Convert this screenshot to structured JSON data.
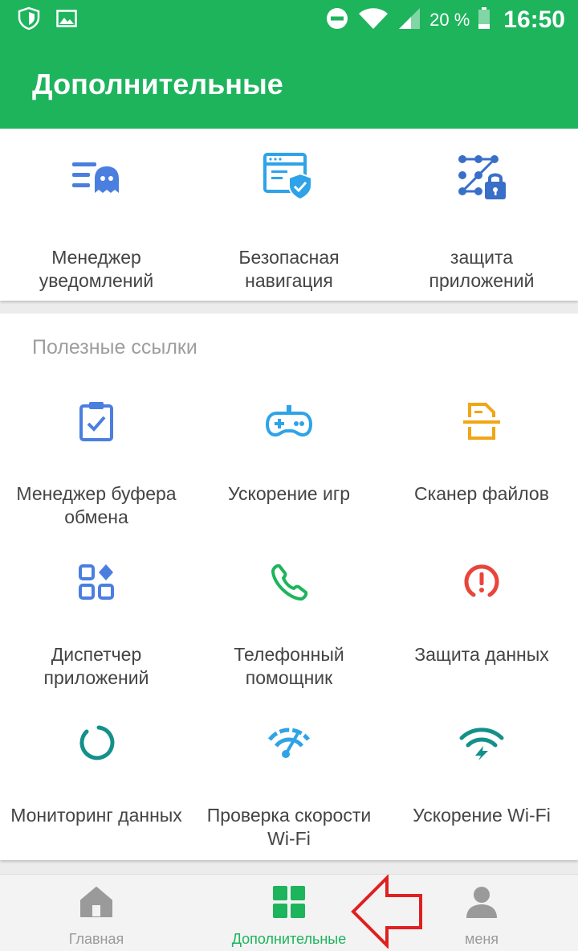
{
  "status_bar": {
    "battery": "20 %",
    "time": "16:50"
  },
  "header": {
    "title": "Дополнительные"
  },
  "top_tools": [
    {
      "line1": "Менеджер",
      "line2": "уведомлений",
      "icon": "notification-manager-icon"
    },
    {
      "line1": "Безопасная",
      "line2": "навигация",
      "icon": "safe-browsing-icon"
    },
    {
      "line1": "защита",
      "line2": "приложений",
      "icon": "app-lock-icon"
    }
  ],
  "useful_links": {
    "title": "Полезные ссылки",
    "items": [
      {
        "line1": "Менеджер буфера",
        "line2": "обмена",
        "icon": "clipboard-icon",
        "color": "#4a7fe0"
      },
      {
        "line1": "Ускорение игр",
        "line2": "",
        "icon": "gamepad-icon",
        "color": "#2ea3e8"
      },
      {
        "line1": "Сканер файлов",
        "line2": "",
        "icon": "file-scanner-icon",
        "color": "#f2a516"
      },
      {
        "line1": "Диспетчер",
        "line2": "приложений",
        "icon": "app-manager-icon",
        "color": "#4a7fe0"
      },
      {
        "line1": "Телефонный",
        "line2": "помощник",
        "icon": "phone-icon",
        "color": "#1db45c"
      },
      {
        "line1": "Защита данных",
        "line2": "",
        "icon": "data-protection-icon",
        "color": "#e8453c"
      },
      {
        "line1": "Мониторинг данных",
        "line2": "",
        "icon": "data-monitor-icon",
        "color": "#14908a"
      },
      {
        "line1": "Проверка скорости",
        "line2": "Wi-Fi",
        "icon": "speedometer-icon",
        "color": "#2ea3e8"
      },
      {
        "line1": "Ускорение Wi-Fi",
        "line2": "",
        "icon": "wifi-boost-icon",
        "color": "#14908a"
      }
    ]
  },
  "bottom_nav": [
    {
      "label": "Главная",
      "icon": "home-icon",
      "active": false
    },
    {
      "label": "Дополнительные",
      "icon": "grid-icon",
      "active": true
    },
    {
      "label": "меня",
      "icon": "person-icon",
      "active": false
    }
  ],
  "colors": {
    "brand_green": "#1db45c",
    "annotation_red": "#e02020"
  }
}
